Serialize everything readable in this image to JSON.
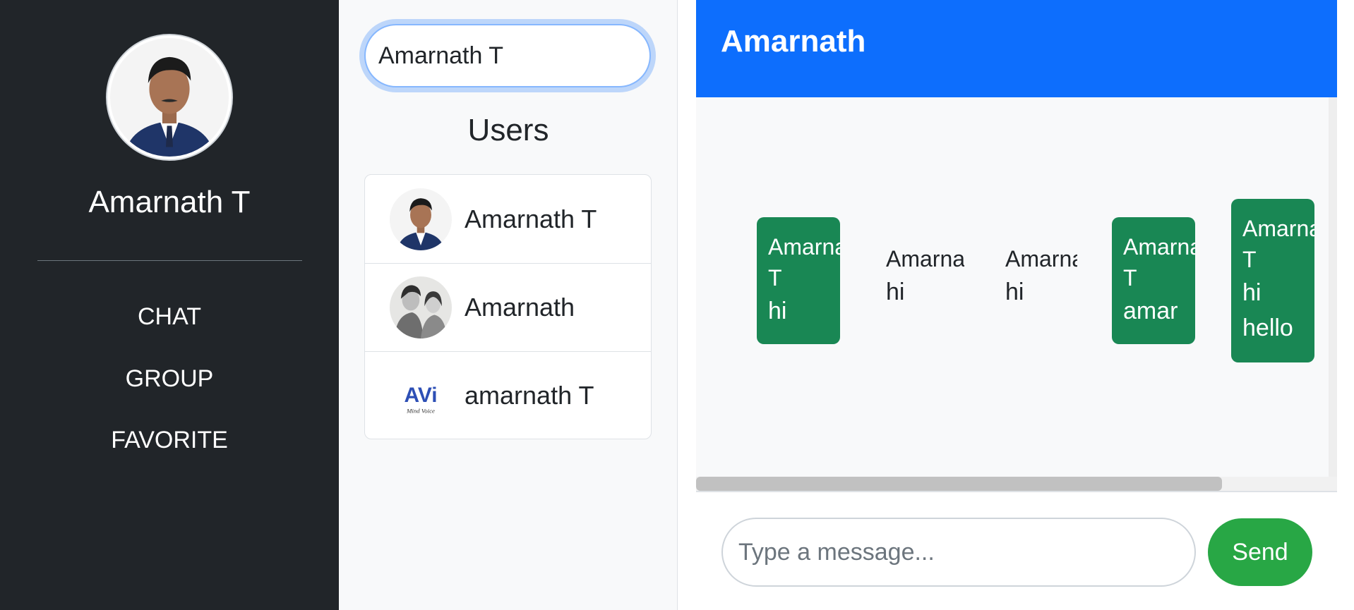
{
  "sidebar": {
    "profile_name": "Amarnath T",
    "nav": [
      "CHAT",
      "GROUP",
      "FAVORITE"
    ]
  },
  "users_panel": {
    "search_value": "Amarnath T",
    "title": "Users",
    "users": [
      {
        "name": "Amarnath T",
        "avatar": "person-photo-avatar"
      },
      {
        "name": "Amarnath",
        "avatar": "sketch-couple-avatar"
      },
      {
        "name": "amarnath T",
        "avatar": "avi-logo-avatar"
      }
    ]
  },
  "chat": {
    "title": "Amarnath",
    "messages": [
      {
        "sender": "Amarnath T",
        "text": "hi",
        "type": "sent"
      },
      {
        "sender": "Amarnath",
        "text": "hi",
        "type": "received"
      },
      {
        "sender": "Amarnath",
        "text": "hi",
        "type": "received"
      },
      {
        "sender": "Amarnath T",
        "text": "amar",
        "type": "sent"
      },
      {
        "sender": "Amarnath T",
        "text": "hi\nhello",
        "type": "sent",
        "lines": [
          "hi",
          "hello"
        ]
      }
    ],
    "input_placeholder": "Type a message...",
    "send_label": "Send"
  },
  "logo_text": {
    "avi": "AVi",
    "tagline": "Mind Voice"
  },
  "colors": {
    "sidebar_bg": "#212529",
    "header_bg": "#0d6efd",
    "sent_bubble": "#198754",
    "send_button": "#28a745",
    "panel_bg": "#f8f9fa"
  }
}
